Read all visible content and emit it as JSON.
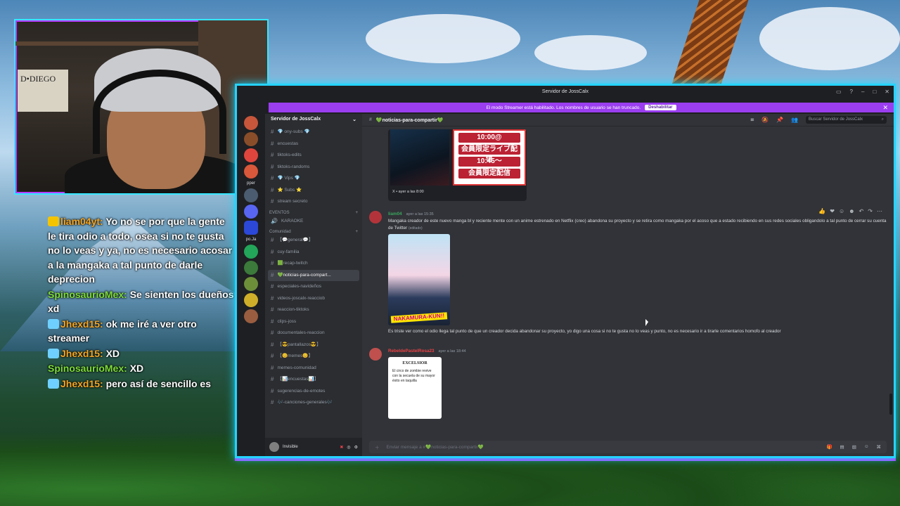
{
  "window": {
    "title": "Servidor de JossCalx",
    "streamer_banner": "El modo Streamer está habilitado. Los nombres de usuario se han truncado.",
    "streamer_button": "Deshabilitar"
  },
  "webcam": {
    "sign_text": "D•DIEGO"
  },
  "stream_chat": [
    {
      "user": "liam04yt:",
      "text": "Yo no se por que la gente le tira odio a todo, osea si no te gusta no lo veas y ya, no es necesario acosar a la mangaka a tal punto de darle deprecion",
      "user_color": "#f5a623",
      "badge": "crown"
    },
    {
      "user": "SpinosaurioMex:",
      "text": "Se sienten los dueños xd",
      "user_color": "#7ddc39",
      "badge": ""
    },
    {
      "user": "Jhexd15:",
      "text": "ok me iré a ver otro streamer",
      "user_color": "#f5a623",
      "badge": "sword"
    },
    {
      "user": "Jhexd15:",
      "text": "XD",
      "user_color": "#f5a623",
      "badge": "sword"
    },
    {
      "user": "SpinosaurioMex:",
      "text": "XD",
      "user_color": "#7ddc39",
      "badge": ""
    },
    {
      "user": "Jhexd15:",
      "text": "pero así de sencillo es",
      "user_color": "#f5a623",
      "badge": "sword"
    }
  ],
  "server_rail": {
    "labels": [
      "pper",
      "po.Ja"
    ]
  },
  "sidebar": {
    "server_name": "Servidor de JossCalx",
    "channels_top": [
      {
        "name": "💎 ony-subs 💎",
        "selected": false
      },
      {
        "name": "encuestas",
        "selected": false
      },
      {
        "name": "tiktoks-edits",
        "selected": false
      },
      {
        "name": "tiktoks-randoms",
        "selected": false
      },
      {
        "name": "💎 Vips 💎",
        "selected": false
      },
      {
        "name": "⭐ Subs ⭐",
        "selected": false
      },
      {
        "name": "stream secreto",
        "selected": false
      }
    ],
    "events_label": "EVENTOS",
    "events": [
      "KARAOKE"
    ],
    "community_label": "Comunidad",
    "channels": [
      {
        "name": "【💬general💬】",
        "selected": false
      },
      {
        "name": "cuy-familia",
        "selected": false
      },
      {
        "name": "🟩recap-twitch",
        "selected": false
      },
      {
        "name": "💚noticias-para-compart...",
        "selected": true
      },
      {
        "name": "especiales-navideños",
        "selected": false
      },
      {
        "name": "videos-joscalx-reacciob",
        "selected": false
      },
      {
        "name": "reaccion-tiktoks",
        "selected": false
      },
      {
        "name": "clips-joss",
        "selected": false
      },
      {
        "name": "documentales-reaccion",
        "selected": false
      },
      {
        "name": "【😎pantallazos😎】",
        "selected": false
      },
      {
        "name": "【😊memes😊】",
        "selected": false
      },
      {
        "name": "memes-comunidad",
        "selected": false
      },
      {
        "name": "【📊encuestas📊】",
        "selected": false
      },
      {
        "name": "sugerencias-de-emotes",
        "selected": false
      },
      {
        "name": "🎶-canciones-generales🎶",
        "selected": false
      }
    ],
    "user_status": "Invisible"
  },
  "main": {
    "channel_title": "💚noticias-para-compartir💚",
    "search_placeholder": "Buscar Servidor de JossCalx",
    "embed_caption": "X • ayer a las 8:00",
    "embed_jp_lines": [
      "10:00@",
      "会員限定ライブ配信",
      "10:45〜",
      "会員限定配信"
    ],
    "messages": [
      {
        "author": "liam04",
        "time": "ayer a las 15:35",
        "text": "Mangaka creador de este nuevo manga bl y reciente mente con un anime estrenado en Netflix (creo) abandona su proyecto y se retira como mangaka por el acoso que a estado recibiendo en sus redes sociales obligandolo a tal punto de cerrar su cuenta de Twitter",
        "edited": "(editado)",
        "image_label": "NAKAMURA-KUN!!"
      },
      {
        "text": "Es triste ver como el odio llega tal punto de que un creador decida abandonar su proyecto, yo digo una cosa si no te gusta no lo veas y punto, no es necesario ir a tirarle comentarios homofo al creador"
      },
      {
        "author": "RebeldePastelRosa23",
        "time": "ayer a las 18:44",
        "news_header": "EXCELSIOR",
        "news_text": "El circo de zombie revive con la secuela de su mayor éxito en taquilla"
      }
    ],
    "composer_placeholder": "Enviar mensaje a #💚noticias-para-compartir💚"
  },
  "colors": {
    "accent_cyan": "#25d3ff",
    "accent_purple": "#9b3ef0",
    "discord_bg": "#313338"
  }
}
